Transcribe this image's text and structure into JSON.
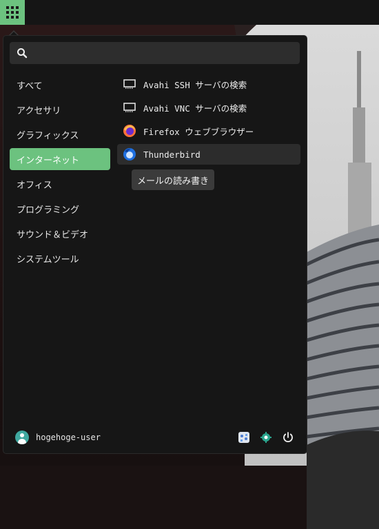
{
  "panel": {
    "apps_button_icon": "grid-icon",
    "accent_color": "#6cc27f"
  },
  "search": {
    "placeholder": "",
    "value": "",
    "icon": "search-icon"
  },
  "categories": [
    {
      "label": "すべて",
      "active": false
    },
    {
      "label": "アクセサリ",
      "active": false
    },
    {
      "label": "グラフィックス",
      "active": false
    },
    {
      "label": "インターネット",
      "active": true
    },
    {
      "label": "オフィス",
      "active": false
    },
    {
      "label": "プログラミング",
      "active": false
    },
    {
      "label": "サウンド＆ビデオ",
      "active": false
    },
    {
      "label": "システムツール",
      "active": false
    }
  ],
  "apps": [
    {
      "label": "Avahi SSH サーバの検索",
      "icon": "network-icon"
    },
    {
      "label": "Avahi VNC サーバの検索",
      "icon": "network-icon"
    },
    {
      "label": "Firefox ウェブブラウザー",
      "icon": "firefox-icon"
    },
    {
      "label": "Thunderbird",
      "icon": "thunderbird-icon",
      "hovered": true
    }
  ],
  "tooltip": {
    "text": "メールの読み書き"
  },
  "user": {
    "name": "hogehoge-user",
    "icon": "avatar-icon"
  },
  "bottom_actions": [
    {
      "icon": "settings-manager-icon"
    },
    {
      "icon": "lock-screen-icon"
    },
    {
      "icon": "power-icon"
    }
  ]
}
